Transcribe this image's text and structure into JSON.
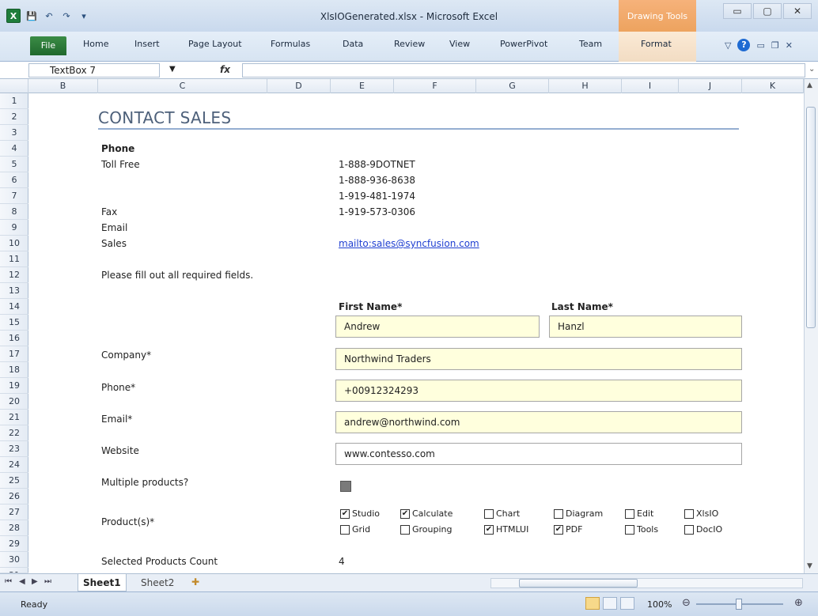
{
  "window": {
    "title": "XlsIOGenerated.xlsx - Microsoft Excel",
    "contextual_group": "Drawing Tools",
    "controls": [
      "▭",
      "▢",
      "✕"
    ]
  },
  "qat": {
    "excel_logo": "X",
    "save": "💾",
    "undo": "↶",
    "redo": "↷",
    "customize": "▾"
  },
  "ribbon": {
    "file": "File",
    "tabs": [
      "Home",
      "Insert",
      "Page Layout",
      "Formulas",
      "Data",
      "Review",
      "View",
      "PowerPivot",
      "Team",
      "Format"
    ],
    "help": "?"
  },
  "formula_bar": {
    "name_box": "TextBox 7",
    "fx": "fx",
    "value": ""
  },
  "columns": [
    "B",
    "C",
    "D",
    "E",
    "F",
    "G",
    "H",
    "I",
    "J",
    "K"
  ],
  "rows": [
    "1",
    "2",
    "3",
    "4",
    "5",
    "6",
    "7",
    "8",
    "9",
    "10",
    "11",
    "12",
    "13",
    "14",
    "15",
    "16",
    "17",
    "18",
    "19",
    "20",
    "21",
    "22",
    "23",
    "24",
    "25",
    "26",
    "27",
    "28",
    "29",
    "30",
    "31"
  ],
  "sheet": {
    "heading": "CONTACT SALES",
    "phone_label": "Phone",
    "toll_free": "Toll Free",
    "numbers": [
      "1-888-9DOTNET",
      "1-888-936-8638",
      "1-919-481-1974"
    ],
    "fax_label": "Fax",
    "fax": "1-919-573-0306",
    "email_label": "Email",
    "sales_label": "Sales",
    "sales_link": "mailto:sales@syncfusion.com",
    "instruction": "Please fill out all required fields.",
    "first_name_label": "First Name*",
    "last_name_label": "Last Name*",
    "first_name": "Andrew",
    "last_name": "Hanzl",
    "company_label": "Company*",
    "company": "Northwind Traders",
    "phone_field_label": "Phone*",
    "phone": "+00912324293",
    "email_field_label": "Email*",
    "email": "andrew@northwind.com",
    "website_label": "Website",
    "website": "www.contesso.com",
    "multiple_label": "Multiple products?",
    "products_label": "Product(s)*",
    "products": [
      {
        "name": "Studio",
        "checked": true
      },
      {
        "name": "Calculate",
        "checked": true
      },
      {
        "name": "Chart",
        "checked": false
      },
      {
        "name": "Diagram",
        "checked": false
      },
      {
        "name": "Edit",
        "checked": false
      },
      {
        "name": "XlsIO",
        "checked": false
      },
      {
        "name": "Grid",
        "checked": false
      },
      {
        "name": "Grouping",
        "checked": false
      },
      {
        "name": "HTMLUI",
        "checked": true
      },
      {
        "name": "PDF",
        "checked": true
      },
      {
        "name": "Tools",
        "checked": false
      },
      {
        "name": "DocIO",
        "checked": false
      }
    ],
    "count_label": "Selected Products Count",
    "count": "4"
  },
  "sheet_tabs": [
    "Sheet1",
    "Sheet2"
  ],
  "status": {
    "ready": "Ready",
    "zoom": "100%"
  }
}
